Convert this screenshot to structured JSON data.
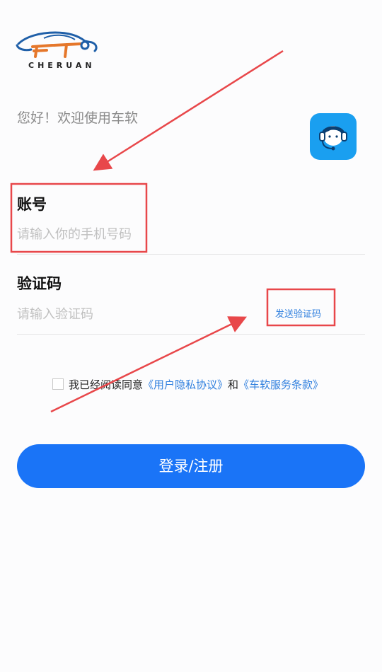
{
  "brand": {
    "logo_text": "CHERUAN"
  },
  "greeting": "您好！欢迎使用车软",
  "support": {
    "icon": "customer-service-headset-icon",
    "color": "#1a9ff0"
  },
  "account": {
    "label": "账号",
    "placeholder": "请输入你的手机号码",
    "value": ""
  },
  "verification": {
    "label": "验证码",
    "placeholder": "请输入验证码",
    "value": "",
    "send_code_label": "发送验证码"
  },
  "agreement": {
    "checked": false,
    "prefix": "我已经阅读同意",
    "privacy_link": "《用户隐私协议》",
    "connector": "和",
    "terms_link": "《车软服务条款》"
  },
  "login_button": {
    "label": "登录/注册",
    "color": "#1a74f7"
  },
  "annotation": {
    "highlight_color": "#e8474a"
  }
}
